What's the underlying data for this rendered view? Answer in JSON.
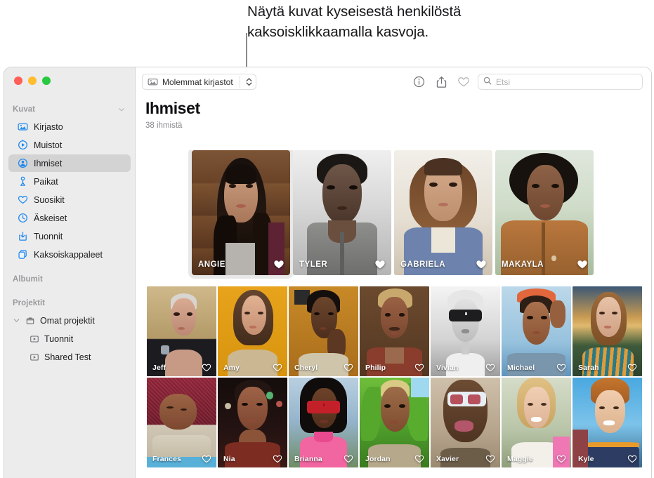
{
  "annotation": {
    "text": "Näytä kuvat kyseisestä henkilöstä kaksoisklikkaamalla kasvoja."
  },
  "sidebar": {
    "groups": [
      {
        "label": "Kuvat",
        "collapsible": true
      },
      {
        "label": "Albumit",
        "collapsible": false
      },
      {
        "label": "Projektit",
        "collapsible": false
      }
    ],
    "items": [
      {
        "label": "Kirjasto",
        "icon": "library-icon",
        "selected": false
      },
      {
        "label": "Muistot",
        "icon": "memories-icon",
        "selected": false
      },
      {
        "label": "Ihmiset",
        "icon": "people-icon",
        "selected": true
      },
      {
        "label": "Paikat",
        "icon": "places-icon",
        "selected": false
      },
      {
        "label": "Suosikit",
        "icon": "heart-icon",
        "selected": false
      },
      {
        "label": "Äskeiset",
        "icon": "recents-icon",
        "selected": false
      },
      {
        "label": "Tuonnit",
        "icon": "import-icon",
        "selected": false
      },
      {
        "label": "Kaksoiskappaleet",
        "icon": "duplicates-icon",
        "selected": false
      }
    ],
    "projects": {
      "root": {
        "label": "Omat projektit",
        "icon": "folder-icon"
      },
      "children": [
        {
          "label": "Tuonnit",
          "icon": "slideshow-icon"
        },
        {
          "label": "Shared Test",
          "icon": "slideshow-icon"
        }
      ]
    }
  },
  "toolbar": {
    "library_picker": {
      "label": "Molemmat kirjastot",
      "icon": "library-icon"
    },
    "info_icon": "info-icon",
    "share_icon": "share-icon",
    "favorite_icon": "heart-icon",
    "search": {
      "placeholder": "Etsi",
      "value": "",
      "icon": "search-icon"
    }
  },
  "main": {
    "title": "Ihmiset",
    "subtitle": "38 ihmistä"
  },
  "people": {
    "featured": [
      {
        "name": "ANGIE",
        "favorite": true,
        "selected": true
      },
      {
        "name": "TYLER",
        "favorite": true,
        "selected": false
      },
      {
        "name": "GABRIELA",
        "favorite": true,
        "selected": false
      },
      {
        "name": "MAKAYLA",
        "favorite": true,
        "selected": false
      }
    ],
    "row2": [
      {
        "name": "Jeff",
        "favorite": false
      },
      {
        "name": "Amy",
        "favorite": false
      },
      {
        "name": "Cheryl",
        "favorite": false
      },
      {
        "name": "Philip",
        "favorite": false
      },
      {
        "name": "Vivian",
        "favorite": false
      },
      {
        "name": "Michael",
        "favorite": false
      },
      {
        "name": "Sarah",
        "favorite": false
      }
    ],
    "row3": [
      {
        "name": "Frances",
        "favorite": false
      },
      {
        "name": "Nia",
        "favorite": false
      },
      {
        "name": "Brianna",
        "favorite": false
      },
      {
        "name": "Jordan",
        "favorite": false
      },
      {
        "name": "Xavier",
        "favorite": false
      },
      {
        "name": "Maggie",
        "favorite": false
      },
      {
        "name": "Kyle",
        "favorite": false
      }
    ]
  },
  "colors": {
    "accent": "#1b86f0",
    "sidebar_bg": "#ececec",
    "selection": "#d3d3d4",
    "traffic_red": "#ff5f57",
    "traffic_yellow": "#febc2e",
    "traffic_green": "#28c840"
  }
}
